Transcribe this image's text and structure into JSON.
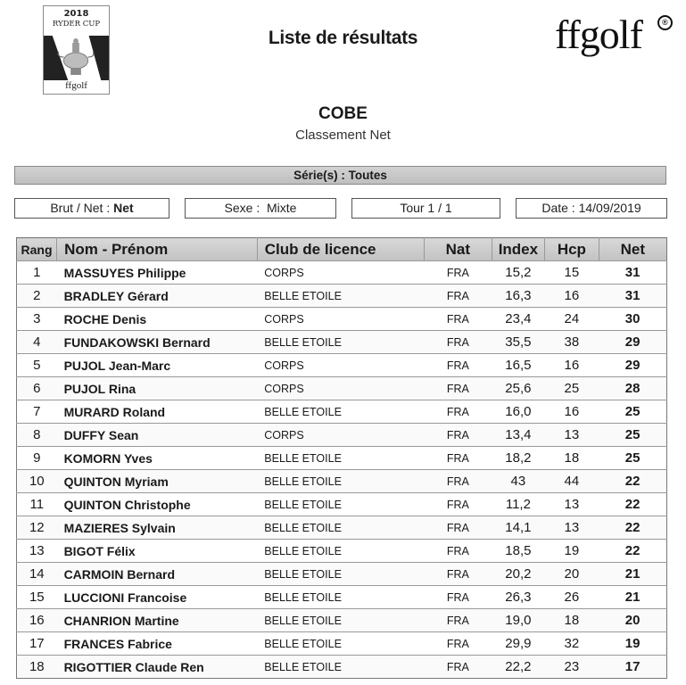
{
  "header": {
    "event_logo": {
      "year": "2018",
      "event": "RYDER CUP",
      "brand": "ffgolf"
    },
    "title": "Liste de résultats",
    "brand_logo": "ffgolf",
    "brand_mark": "registered-icon"
  },
  "competition": {
    "name": "COBE",
    "ranking_type": "Classement Net"
  },
  "series": "Série(s) : Toutes",
  "filters": {
    "brut_net_label": "Brut / Net :",
    "brut_net_value": "Net",
    "sexe_label": "Sexe :",
    "sexe_value": "Mixte",
    "tour": "Tour 1 / 1",
    "date_label": "Date :",
    "date_value": "14/09/2019"
  },
  "table": {
    "columns": [
      "Rang",
      "Nom - Prénom",
      "Club de licence",
      "Nat",
      "Index",
      "Hcp",
      "Net"
    ],
    "rows": [
      {
        "rang": "1",
        "nom": "MASSUYES Philippe",
        "club": "CORPS",
        "nat": "FRA",
        "index": "15,2",
        "hcp": "15",
        "net": "31"
      },
      {
        "rang": "2",
        "nom": "BRADLEY Gérard",
        "club": "BELLE ETOILE",
        "nat": "FRA",
        "index": "16,3",
        "hcp": "16",
        "net": "31"
      },
      {
        "rang": "3",
        "nom": "ROCHE Denis",
        "club": "CORPS",
        "nat": "FRA",
        "index": "23,4",
        "hcp": "24",
        "net": "30"
      },
      {
        "rang": "4",
        "nom": "FUNDAKOWSKI Bernard",
        "club": "BELLE ETOILE",
        "nat": "FRA",
        "index": "35,5",
        "hcp": "38",
        "net": "29"
      },
      {
        "rang": "5",
        "nom": "PUJOL Jean-Marc",
        "club": "CORPS",
        "nat": "FRA",
        "index": "16,5",
        "hcp": "16",
        "net": "29"
      },
      {
        "rang": "6",
        "nom": "PUJOL Rina",
        "club": "CORPS",
        "nat": "FRA",
        "index": "25,6",
        "hcp": "25",
        "net": "28"
      },
      {
        "rang": "7",
        "nom": "MURARD Roland",
        "club": "BELLE ETOILE",
        "nat": "FRA",
        "index": "16,0",
        "hcp": "16",
        "net": "25"
      },
      {
        "rang": "8",
        "nom": "DUFFY Sean",
        "club": "CORPS",
        "nat": "FRA",
        "index": "13,4",
        "hcp": "13",
        "net": "25"
      },
      {
        "rang": "9",
        "nom": "KOMORN Yves",
        "club": "BELLE ETOILE",
        "nat": "FRA",
        "index": "18,2",
        "hcp": "18",
        "net": "25"
      },
      {
        "rang": "10",
        "nom": "QUINTON Myriam",
        "club": "BELLE ETOILE",
        "nat": "FRA",
        "index": "43",
        "hcp": "44",
        "net": "22"
      },
      {
        "rang": "11",
        "nom": "QUINTON Christophe",
        "club": "BELLE ETOILE",
        "nat": "FRA",
        "index": "11,2",
        "hcp": "13",
        "net": "22"
      },
      {
        "rang": "12",
        "nom": "MAZIERES Sylvain",
        "club": "BELLE ETOILE",
        "nat": "FRA",
        "index": "14,1",
        "hcp": "13",
        "net": "22"
      },
      {
        "rang": "13",
        "nom": "BIGOT Félix",
        "club": "BELLE ETOILE",
        "nat": "FRA",
        "index": "18,5",
        "hcp": "19",
        "net": "22"
      },
      {
        "rang": "14",
        "nom": "CARMOIN Bernard",
        "club": "BELLE ETOILE",
        "nat": "FRA",
        "index": "20,2",
        "hcp": "20",
        "net": "21"
      },
      {
        "rang": "15",
        "nom": "LUCCIONI Francoise",
        "club": "BELLE ETOILE",
        "nat": "FRA",
        "index": "26,3",
        "hcp": "26",
        "net": "21"
      },
      {
        "rang": "16",
        "nom": "CHANRION Martine",
        "club": "BELLE ETOILE",
        "nat": "FRA",
        "index": "19,0",
        "hcp": "18",
        "net": "20"
      },
      {
        "rang": "17",
        "nom": "FRANCES Fabrice",
        "club": "BELLE ETOILE",
        "nat": "FRA",
        "index": "29,9",
        "hcp": "32",
        "net": "19"
      },
      {
        "rang": "18",
        "nom": "RIGOTTIER Claude Ren",
        "club": "BELLE ETOILE",
        "nat": "FRA",
        "index": "22,2",
        "hcp": "23",
        "net": "17"
      }
    ]
  }
}
